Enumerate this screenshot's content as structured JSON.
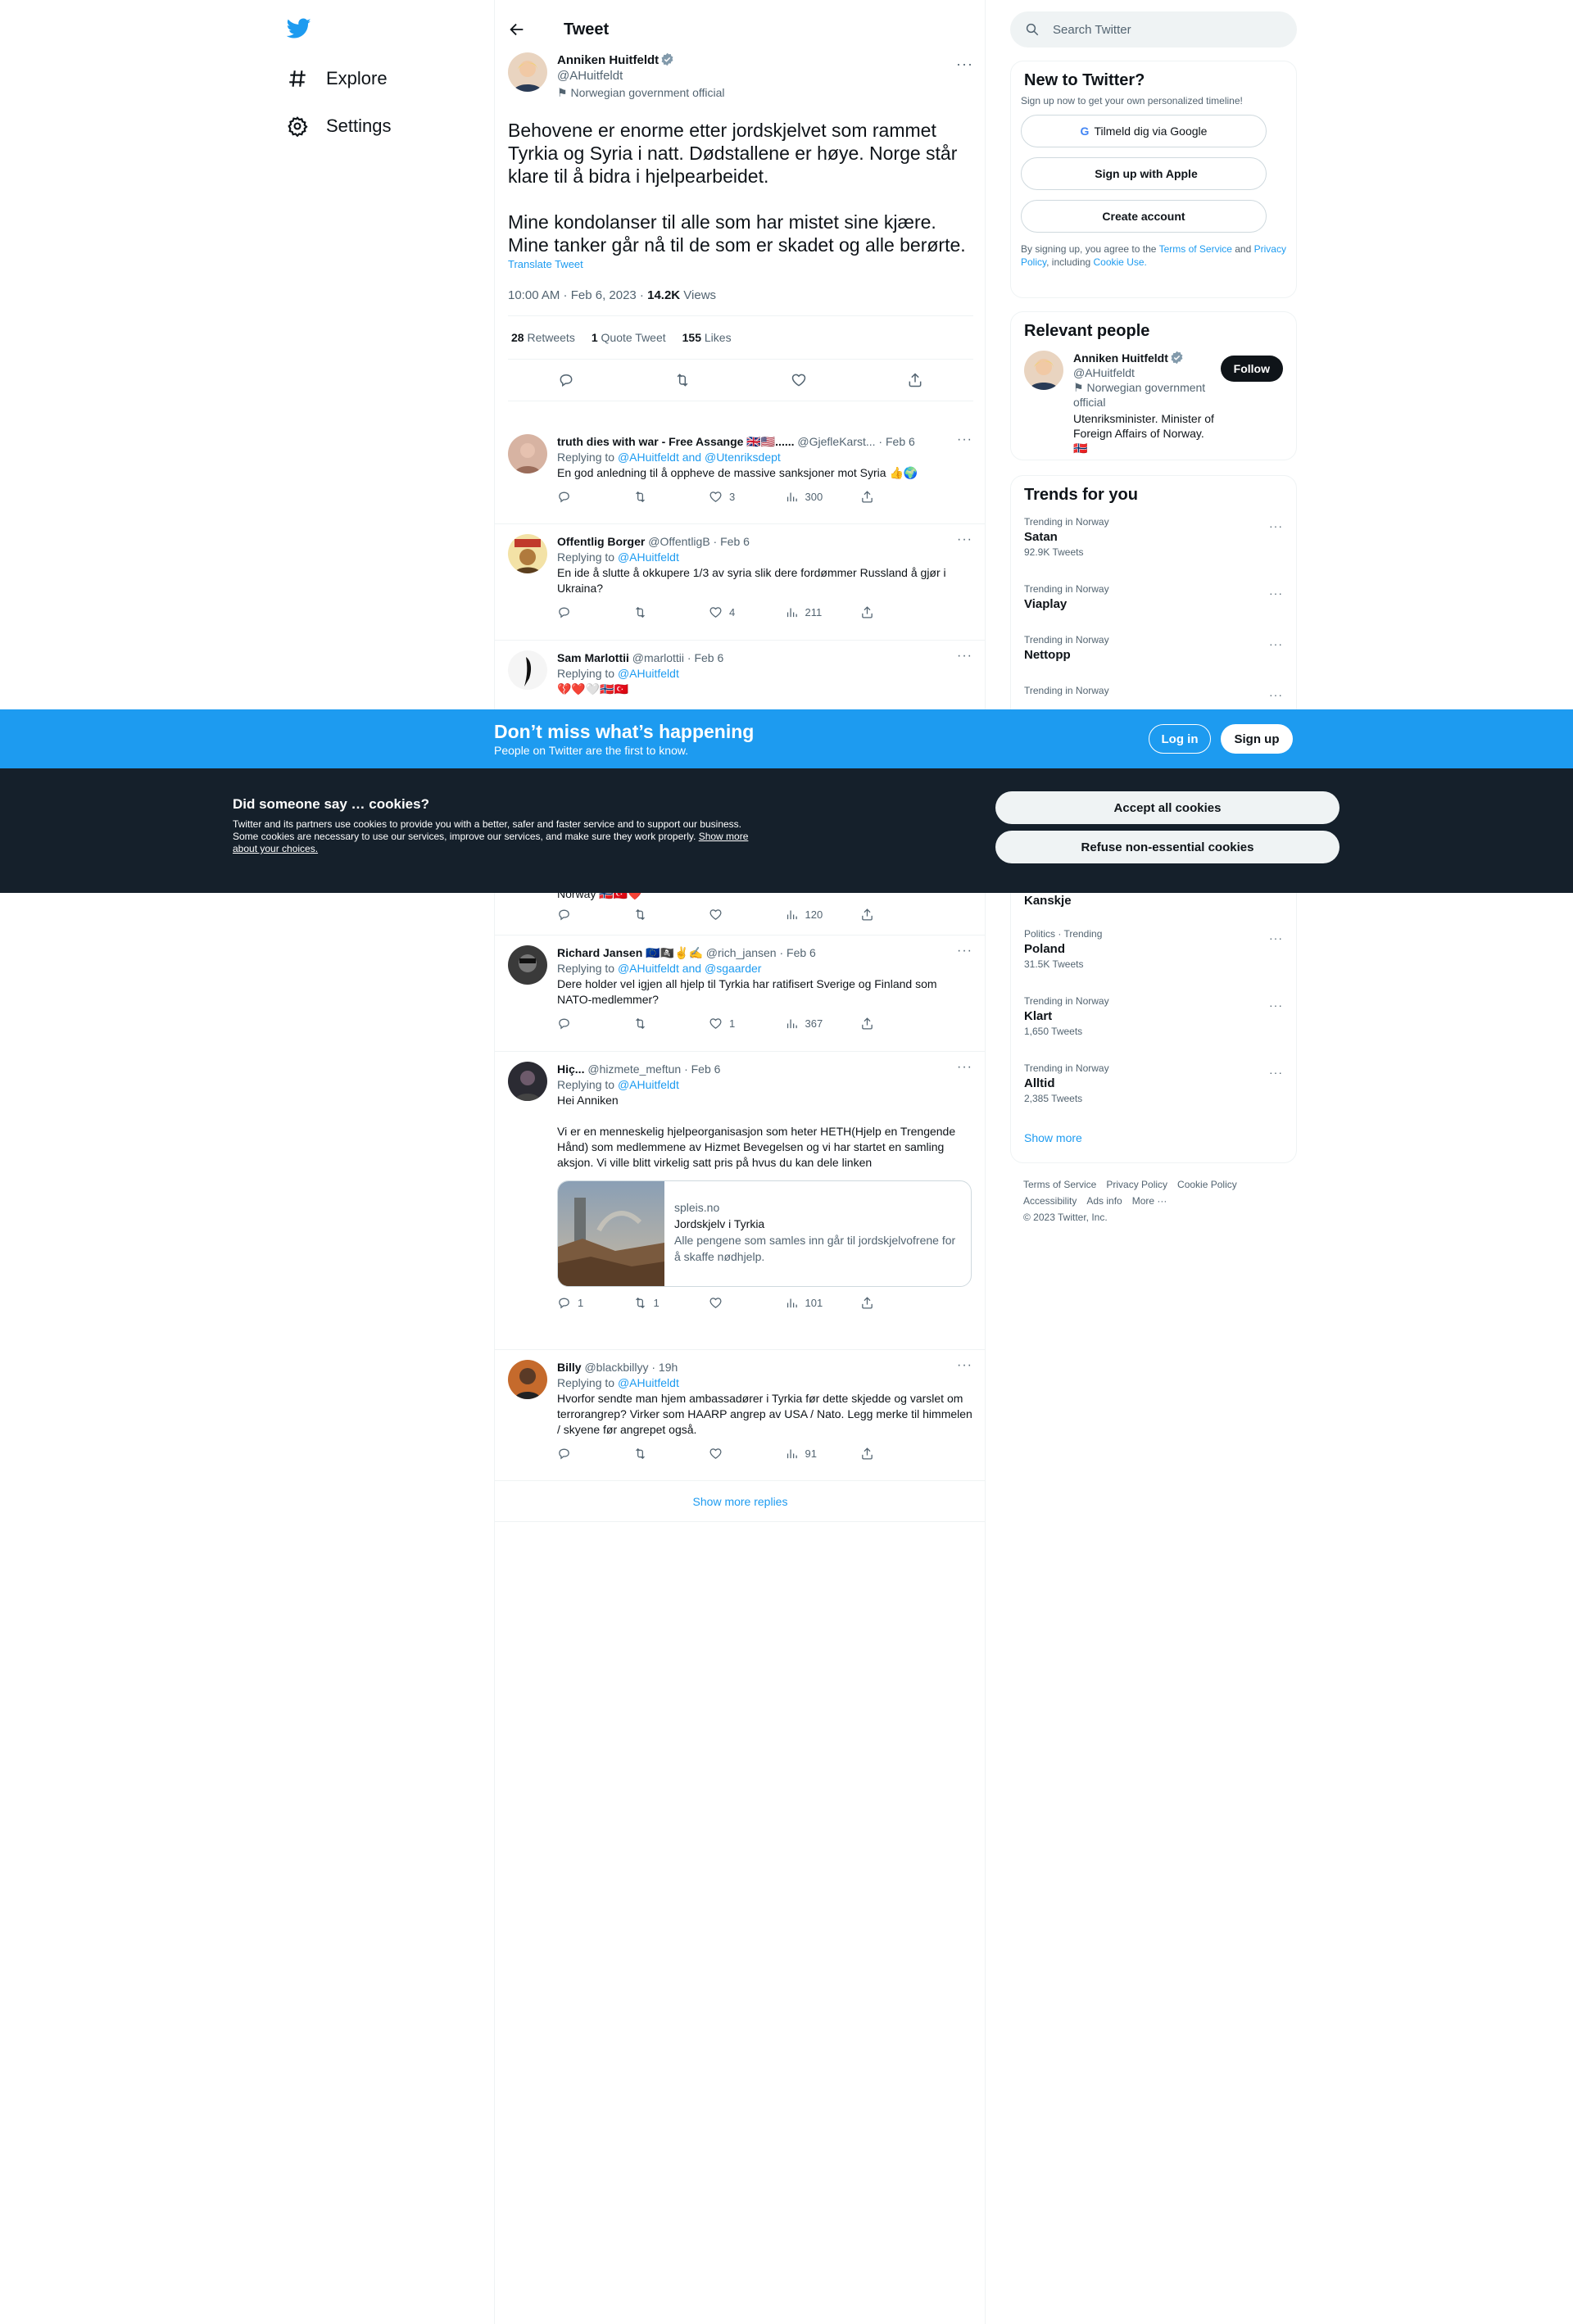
{
  "nav": {
    "items": [
      {
        "label": "Explore",
        "icon": "hashtag-icon"
      },
      {
        "label": "Settings",
        "icon": "gear-icon"
      }
    ]
  },
  "header": {
    "title": "Tweet"
  },
  "main_tweet": {
    "name": "Anniken Huitfeldt",
    "handle": "@AHuitfeldt",
    "affiliation": "Norwegian government official",
    "body": "Behovene er enorme etter jordskjelvet som rammet Tyrkia og Syria i natt. Dødstallene er høye. Norge står klare til å bidra i hjelpearbeidet.\n\nMine kondolanser til alle som har mistet sine kjære. Mine tanker går nå til de som er skadet og alle berørte.",
    "translate": "Translate Tweet",
    "time": "10:00 AM · Feb 6, 2023 · ",
    "views_count": "14.2K",
    "views_label": " Views",
    "retweets_count": "28",
    "retweets_label": " Retweets",
    "quotes_count": "1",
    "quotes_label": " Quote Tweet",
    "likes_count": "155",
    "likes_label": " Likes"
  },
  "replies": [
    {
      "name": "truth dies with war - Free Assange 🇬🇧🇺🇸......",
      "handle_date": " @GjefleKarst... · Feb 6",
      "replying_prefix": "Replying to ",
      "replying_to": "@AHuitfeldt and @Utenriksdept",
      "text": "En god anledning til å oppheve de massive sanksjoner mot Syria 👍🌍",
      "reply_count": "",
      "retweet_count": "",
      "like_count": "3",
      "view_count": "300"
    },
    {
      "name": "Offentlig Borger",
      "handle_date": " @OffentligB · Feb 6",
      "replying_prefix": "Replying to ",
      "replying_to": "@AHuitfeldt",
      "text": "En ide å slutte å okkupere 1/3 av syria slik dere fordømmer Russland å gjør i Ukraina?",
      "reply_count": "",
      "retweet_count": "",
      "like_count": "4",
      "view_count": "211"
    },
    {
      "name": "Sam Marlottii",
      "handle_date": "  @marlottii · Feb 6",
      "replying_prefix": "Replying to ",
      "replying_to": "@AHuitfeldt",
      "text": "💔❤️🤍🇳🇴🇹🇷"
    },
    {
      "partial_text": "Norway 🇳🇴🇹🇷❤️",
      "reply_count": "",
      "retweet_count": "",
      "like_count": "",
      "view_count": "120"
    },
    {
      "name": "Richard Jansen 🇪🇺🏴‍☠️✌️✍️",
      "handle_date": " @rich_jansen · Feb 6",
      "replying_prefix": "Replying to ",
      "replying_to": "@AHuitfeldt and @sgaarder",
      "text": "Dere holder vel igjen all hjelp til Tyrkia har ratifisert Sverige og Finland som NATO-medlemmer?",
      "reply_count": "",
      "retweet_count": "",
      "like_count": "1",
      "view_count": "367"
    },
    {
      "name": "Hiç...",
      "handle_date": " @hizmete_meftun · Feb 6",
      "replying_prefix": "Replying to ",
      "replying_to": "@AHuitfeldt",
      "text": "Hei Anniken\n\nVi er en menneskelig hjelpeorganisasjon som heter HETH(Hjelp en Trengende Hånd) som medlemmene av Hizmet Bevegelsen og vi har startet en samling aksjon. Vi ville blitt virkelig satt pris på hvus du kan dele linken",
      "card": {
        "domain": "spleis.no",
        "title": "Jordskjelv i Tyrkia",
        "desc": "Alle pengene som samles inn går til jordskjelvofrene for å skaffe nødhjelp."
      },
      "reply_count": "1",
      "retweet_count": "1",
      "like_count": "",
      "view_count": "101"
    },
    {
      "name": "Billy",
      "handle_date": " @blackbillyy · 19h",
      "replying_prefix": "Replying to ",
      "replying_to": "@AHuitfeldt",
      "text": "Hvorfor sendte man hjem ambassadører i Tyrkia før dette skjedde og varslet om terrorangrep? Virker som HAARP angrep av USA / Nato. Legg merke til himmelen / skyene før angrepet også.",
      "reply_count": "",
      "retweet_count": "",
      "like_count": "",
      "view_count": "91"
    }
  ],
  "show_more_replies": "Show more replies",
  "search": {
    "placeholder": "Search Twitter"
  },
  "signup_box": {
    "title": "New to Twitter?",
    "subtitle": "Sign up now to get your own personalized timeline!",
    "google": "Tilmeld dig via Google",
    "apple": "Sign up with Apple",
    "create": "Create account",
    "legal_1": "By signing up, you agree to the ",
    "terms": "Terms of Service",
    "legal_2": " and ",
    "privacy": "Privacy Policy",
    "legal_3": ", including ",
    "cookie": "Cookie Use."
  },
  "relevant": {
    "title": "Relevant people",
    "name": "Anniken Huitfeldt",
    "handle": "@AHuitfeldt",
    "affiliation": "Norwegian government official",
    "bio": "Utenriksminister. Minister of Foreign Affairs of Norway. 🇳🇴",
    "follow": "Follow"
  },
  "trends": {
    "title": "Trends for you",
    "items_top": [
      {
        "category": "Trending in Norway",
        "name": "Satan",
        "count": "92.9K Tweets"
      },
      {
        "category": "Trending in Norway",
        "name": "Viaplay",
        "count": ""
      },
      {
        "category": "Trending in Norway",
        "name": "Nettopp",
        "count": ""
      },
      {
        "category": "Trending in Norway",
        "name": "",
        "count": ""
      }
    ],
    "partial_name": "Kanskje",
    "items_bottom": [
      {
        "category": "Politics · Trending",
        "name": "Poland",
        "count": "31.5K Tweets"
      },
      {
        "category": "Trending in Norway",
        "name": "Klart",
        "count": "1,650 Tweets"
      },
      {
        "category": "Trending in Norway",
        "name": "Alltid",
        "count": "2,385 Tweets"
      }
    ],
    "show_more": "Show more"
  },
  "footer": {
    "terms": "Terms of Service",
    "privacy": "Privacy Policy",
    "cookie": "Cookie Policy",
    "accessibility": "Accessibility",
    "ads": "Ads info",
    "more": "More ···",
    "copyright": "© 2023 Twitter, Inc."
  },
  "banner": {
    "title": "Don’t miss what’s happening",
    "subtitle": "People on Twitter are the first to know.",
    "login": "Log in",
    "signup": "Sign up"
  },
  "cookies": {
    "title": "Did someone say … cookies?",
    "body": "Twitter and its partners use cookies to provide you with a better, safer and faster service and to support our business. Some cookies are necessary to use our services, improve our services, and make sure they work properly. ",
    "link": "Show more about your choices.",
    "accept": "Accept all cookies",
    "refuse": "Refuse non-essential cookies"
  },
  "colors": {
    "accent": "#1d9bf0",
    "text": "#0f1419",
    "muted": "#536471",
    "cookie_bg": "#15202b"
  }
}
